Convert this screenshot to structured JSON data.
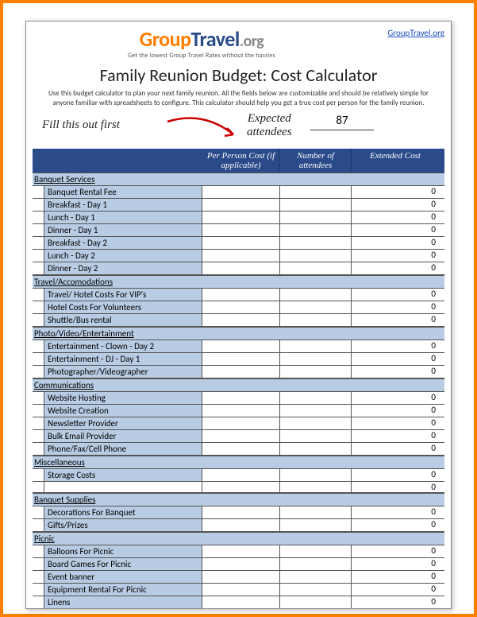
{
  "logo": {
    "group": "Group",
    "travel": "Travel",
    "dot": ".",
    "org": "org",
    "tagline": "Get the lowest Group Travel Rates without the hassles"
  },
  "top_link": "GroupTravel.org",
  "title": "Family Reunion Budget: Cost Calculator",
  "instructions": "Use this budget calculator to plan your next family reunion. All the fields below are customizable and should be relatively simple for anyone familiar with spreadsheets to configure. This calculator should help you get a true cost per person for the family reunion.",
  "hint1": "Fill this out first",
  "hint2_line1": "Expected",
  "hint2_line2": "attendees",
  "attendees": "87",
  "headers": {
    "ppc": "Per Person Cost (if applicable)",
    "num": "Number of attendees",
    "ext": "Extended Cost"
  },
  "sections": [
    {
      "title": "Banquet Services",
      "rows": [
        {
          "label": "Banquet Rental Fee",
          "ext": "0"
        },
        {
          "label": "Breakfast - Day 1",
          "ext": "0"
        },
        {
          "label": "Lunch - Day 1",
          "ext": "0"
        },
        {
          "label": "Dinner - Day 1",
          "ext": "0"
        },
        {
          "label": "Breakfast - Day 2",
          "ext": "0"
        },
        {
          "label": "Lunch - Day 2",
          "ext": "0"
        },
        {
          "label": "Dinner - Day 2",
          "ext": "0"
        }
      ]
    },
    {
      "title": "Travel/Accomodations",
      "rows": [
        {
          "label": "Travel/ Hotel Costs For VIP's",
          "ext": "0"
        },
        {
          "label": "Hotel Costs For Volunteers",
          "ext": "0"
        },
        {
          "label": "Shuttle/Bus rental",
          "ext": "0"
        }
      ]
    },
    {
      "title": "Photo/Video/Entertainment",
      "rows": [
        {
          "label": "Entertainment - Clown - Day 2",
          "ext": "0"
        },
        {
          "label": "Entertainment - DJ - Day 1",
          "ext": "0"
        },
        {
          "label": "Photographer/Videographer",
          "ext": "0"
        }
      ]
    },
    {
      "title": "Communications",
      "rows": [
        {
          "label": "Website Hosting",
          "ext": "0"
        },
        {
          "label": "Website Creation",
          "ext": "0"
        },
        {
          "label": "Newsletter Provider",
          "ext": "0"
        },
        {
          "label": "Bulk Email Provider",
          "ext": "0"
        },
        {
          "label": "Phone/Fax/Cell Phone",
          "ext": "0"
        }
      ]
    },
    {
      "title": "Miscellaneous",
      "rows": [
        {
          "label": "Storage Costs",
          "ext": "0"
        },
        {
          "label": "",
          "ext": "0",
          "empty": true
        }
      ]
    },
    {
      "title": "Banquet Supplies",
      "rows": [
        {
          "label": "Decorations For Banquet",
          "ext": "0"
        },
        {
          "label": "Gifts/Prizes",
          "ext": "0"
        }
      ]
    },
    {
      "title": "Picnic",
      "rows": [
        {
          "label": "Balloons For Picnic",
          "ext": "0"
        },
        {
          "label": "Board Games For Picnic",
          "ext": "0"
        },
        {
          "label": "Event banner",
          "ext": "0"
        },
        {
          "label": "Equipment Rental For Picnic",
          "ext": "0"
        },
        {
          "label": "Linens",
          "ext": "0"
        }
      ]
    }
  ]
}
